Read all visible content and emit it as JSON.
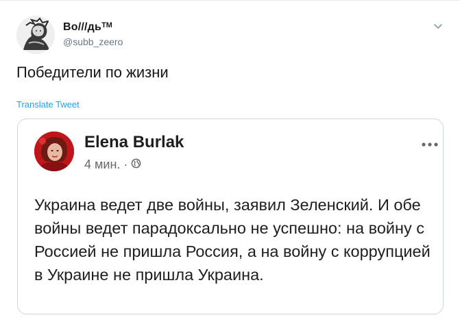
{
  "tweet": {
    "display_name": "Во///дьᵀᴹ",
    "handle": "@subb_zeero",
    "text": "Победители по жизни",
    "translate_label": "Translate Tweet"
  },
  "quoted_post": {
    "author_name": "Elena Burlak",
    "time": "4 мин.",
    "separator": "·",
    "audience_icon": "globe-icon",
    "body": "Украина ведет две войны, заявил Зеленский. И обе войны ведет парадоксально не успешно: на войну с Россией не пришла Россия, а на войну с коррупцией в Украине не пришла Украина."
  },
  "colors": {
    "link": "#1da1f2",
    "secondary_text": "#657786",
    "border": "#ccd6dd"
  }
}
